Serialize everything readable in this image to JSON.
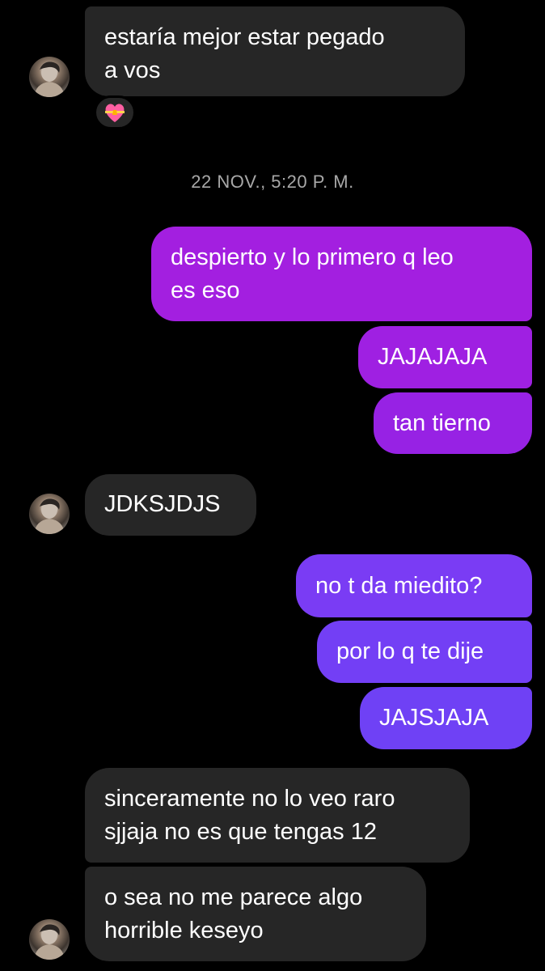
{
  "timestamp": "22 NOV., 5:20 P. M.",
  "messages": {
    "m1": "estaría mejor estar pegado\na vos",
    "m2": "despierto y lo primero q leo\nes eso",
    "m3": "JAJAJAJA",
    "m4": "tan tierno",
    "m5": "JDKSJDJS",
    "m6": "no t da miedito?",
    "m7": "por lo q te dije",
    "m8": "JAJSJAJA",
    "m9": "sinceramente no lo veo raro\nsjjaja no es que tengas 12",
    "m10": "o sea no me parece algo\nhorrible keseyo"
  },
  "reaction": {
    "icon": "heart-with-ribbon-icon"
  },
  "colors": {
    "incoming_bubble": "#262626",
    "outgoing_top": "#a31fe0",
    "outgoing_bottom": "#6f41f5",
    "timestamp": "#a8a8a8"
  }
}
